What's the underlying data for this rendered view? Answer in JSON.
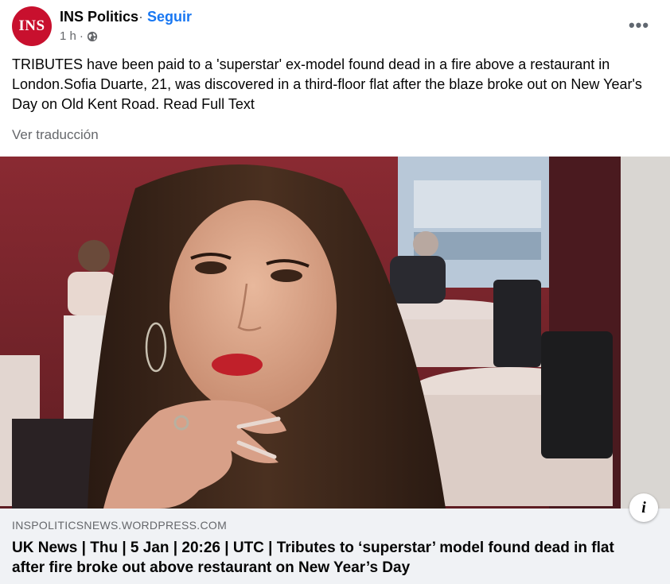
{
  "post": {
    "avatar_text": "INS",
    "page_name": "INS Politics",
    "separator": "·",
    "follow_label": "Seguir",
    "time": "1 h",
    "privacy_icon": "globe-icon",
    "more_icon": "more-dots-icon",
    "body": "TRIBUTES have been paid to a 'superstar' ex-model found dead in a fire above a restaurant in London.Sofia Duarte, 21, was discovered in a third-floor flat after the blaze broke out on New Year's Day on Old Kent Road. Read Full Text",
    "translate_label": "Ver traducción"
  },
  "link_preview": {
    "domain": "INSPOLITICSNEWS.WORDPRESS.COM",
    "title": "UK News | Thu | 5 Jan | 20:26 | UTC | Tributes to ‘superstar’ model found dead in flat after fire broke out above restaurant on New Year’s Day",
    "info_icon": "info-icon",
    "info_label": "i"
  },
  "colors": {
    "avatar_bg": "#c8102e",
    "follow_blue": "#1877f2",
    "secondary_text": "#65676b",
    "link_bg": "#f0f2f5"
  }
}
